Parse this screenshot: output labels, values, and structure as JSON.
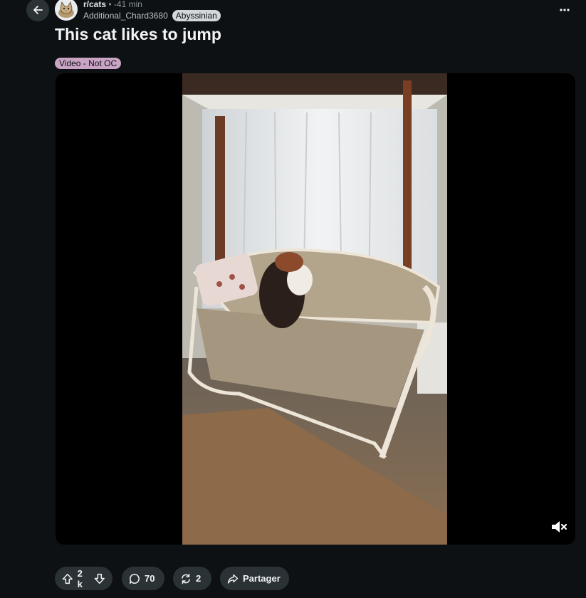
{
  "post": {
    "subreddit": "r/cats",
    "separator": "•",
    "time": "-41 min",
    "author": "Additional_Chard3680",
    "author_flair": "Abyssinian",
    "title": "This cat likes to jump",
    "post_flair": "Video - Not OC"
  },
  "actions": {
    "votes": "2 k",
    "comments": "70",
    "crossposts": "2",
    "share_label": "Partager"
  },
  "icons": {
    "back": "back-arrow-icon",
    "more": "more-icon",
    "mute": "muted-speaker-icon",
    "upvote": "upvote-icon",
    "downvote": "downvote-icon",
    "comment": "comment-icon",
    "crosspost": "crosspost-icon",
    "share": "share-icon"
  },
  "colors": {
    "background": "#0e1113",
    "button_background": "#2a3236",
    "post_flair": "#c9a4c4",
    "user_flair": "#d4d7d9"
  }
}
